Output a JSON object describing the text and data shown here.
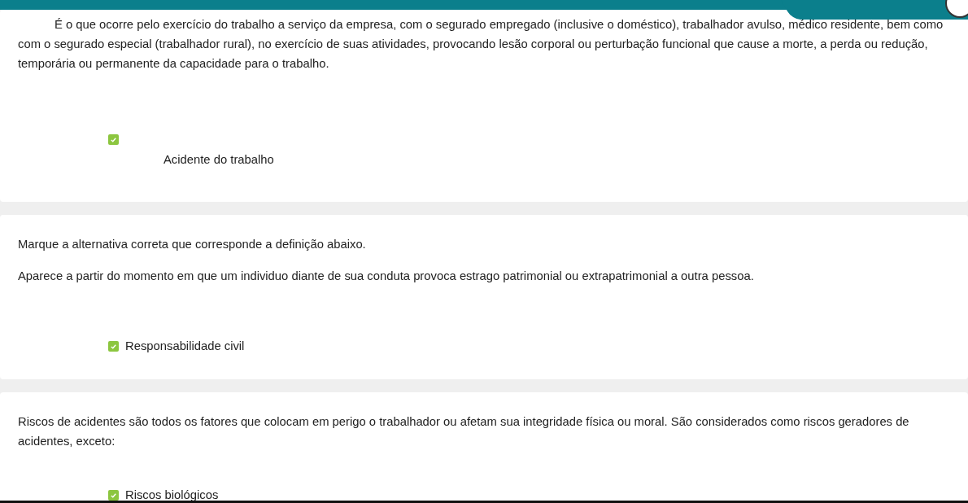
{
  "questions": [
    {
      "kind": "indented",
      "statement": "É o que ocorre pelo exercício do trabalho a serviço da empresa, com o segurado empregado (inclusive o doméstico), trabalhador avulso, médico residente, bem como com o segurado especial (trabalhador rural), no exercício de suas atividades, provocando lesão corporal ou perturbação funcional que cause a morte, a perda ou redução, temporária ou permanente da capacidade para o trabalho.",
      "answer": {
        "label": "Acidente do trabalho",
        "checked": true
      }
    },
    {
      "kind": "plain",
      "prompt": "Marque a alternativa correta que corresponde a definição abaixo.",
      "statement": "Aparece a partir do momento em que um individuo diante de sua conduta provoca estrago patrimonial ou extrapatrimonial a outra pessoa.",
      "answer": {
        "label": "Responsabilidade civil",
        "checked": true
      }
    },
    {
      "kind": "plain",
      "statement": "Riscos de acidentes são todos os fatores que colocam em perigo o trabalhador ou afetam sua integridade física ou moral. São considerados como riscos geradores de acidentes, exceto:",
      "answer": {
        "label": "Riscos biológicos",
        "checked": true
      }
    }
  ]
}
